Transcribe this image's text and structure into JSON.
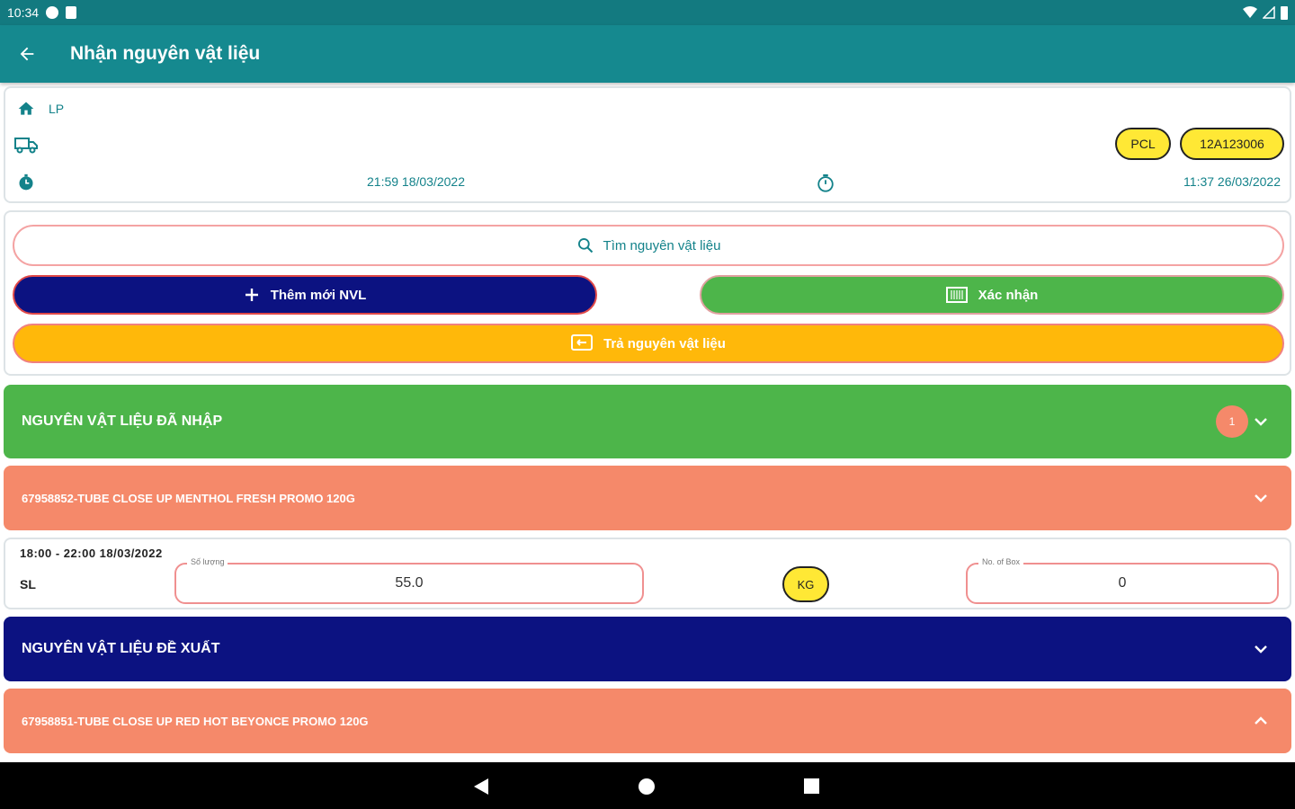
{
  "status_bar": {
    "time": "10:34"
  },
  "app_bar": {
    "title": "Nhận nguyên vật liệu"
  },
  "info": {
    "location": "LP",
    "chips": [
      "PCL",
      "12A123006"
    ],
    "start_time": "21:59 18/03/2022",
    "end_time": "11:37 26/03/2022"
  },
  "actions": {
    "search_label": "Tìm nguyên vật liệu",
    "add_label": "Thêm mới NVL",
    "confirm_label": "Xác nhận",
    "return_label": "Trả nguyên vật liệu"
  },
  "sections": {
    "received_title": "NGUYÊN VẬT LIỆU ĐÃ NHẬP",
    "received_count": "1",
    "item1": "67958852-TUBE CLOSE UP MENTHOL FRESH PROMO 120G",
    "suggested_title": "NGUYÊN VẬT LIỆU ĐỀ XUẤT",
    "item2": "67958851-TUBE CLOSE UP RED HOT BEYONCE PROMO 120G"
  },
  "detail": {
    "time_range": "18:00 - 22:00   18/03/2022",
    "sl_label": "SL",
    "quantity_label": "Số lượng",
    "quantity_value": "55.0",
    "unit": "KG",
    "box_label": "No. of Box",
    "box_value": "0"
  },
  "colors": {
    "primary": "#15898f",
    "green": "#4db54a",
    "navy": "#0c1281",
    "orange": "#f5896a",
    "amber": "#ffb80a",
    "chip": "#ffe835"
  }
}
